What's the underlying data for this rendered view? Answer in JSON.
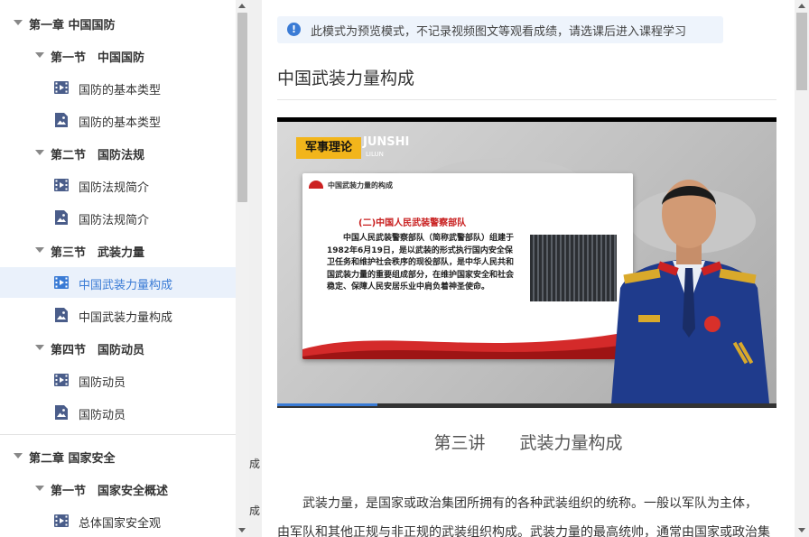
{
  "sidebar": {
    "items": [
      {
        "label": "第一章 中国国防",
        "level": 0,
        "type": "chapter"
      },
      {
        "label": "第一节　中国国防",
        "level": 1,
        "type": "section"
      },
      {
        "label": "国防的基本类型",
        "level": 2,
        "type": "video"
      },
      {
        "label": "国防的基本类型",
        "level": 2,
        "type": "doc"
      },
      {
        "label": "第二节　国防法规",
        "level": 1,
        "type": "section"
      },
      {
        "label": "国防法规简介",
        "level": 2,
        "type": "video"
      },
      {
        "label": "国防法规简介",
        "level": 2,
        "type": "doc"
      },
      {
        "label": "第三节　武装力量",
        "level": 1,
        "type": "section"
      },
      {
        "label": "中国武装力量构成",
        "level": 2,
        "type": "video",
        "active": true
      },
      {
        "label": "中国武装力量构成",
        "level": 2,
        "type": "doc"
      },
      {
        "label": "第四节　国防动员",
        "level": 1,
        "type": "section"
      },
      {
        "label": "国防动员",
        "level": 2,
        "type": "video"
      },
      {
        "label": "国防动员",
        "level": 2,
        "type": "doc"
      },
      {
        "label": "第二章 国家安全",
        "level": 0,
        "type": "chapter"
      },
      {
        "label": "第一节　国家安全概述",
        "level": 1,
        "type": "section"
      },
      {
        "label": "总体国家安全观",
        "level": 2,
        "type": "video"
      }
    ]
  },
  "gap": {
    "chars": [
      "成",
      "成"
    ]
  },
  "main": {
    "notice": "此模式为预览模式，不记录视频图文等观看成绩，请选课后进入课程学习",
    "notice_icon": "!",
    "title": "中国武装力量构成",
    "video": {
      "brand": "军事理论",
      "brand_en": "JUNSHI",
      "brand_en2": "LILUN",
      "slide_header": "中国武装力量的构成",
      "slide_subtitle": "(二)中国人民武装警察部队",
      "slide_body": "　　中国人民武装警察部队（简称武警部队）组建于1982年6月19日，是以武装的形式执行国内安全保卫任务和维护社会秩序的现役部队，是中华人民共和国武装力量的重要组成部分，在维护国家安全和社会稳定、保障人民安居乐业中肩负着神圣使命。",
      "progress": 0.2
    },
    "lecture_title": "第三讲　　武装力量构成",
    "paragraph_line1": "　　武装力量，是国家或政治集团所拥有的各种武装组织的统称。一般以军队为主体，",
    "paragraph_line2": "由军队和其他正规与非正规的武装组织构成。武装力量的最高统帅，通常由国家或政治集"
  },
  "colors": {
    "accent": "#3a7bd5",
    "brand": "#f2b51b",
    "active_bg": "#eaf1fb"
  }
}
